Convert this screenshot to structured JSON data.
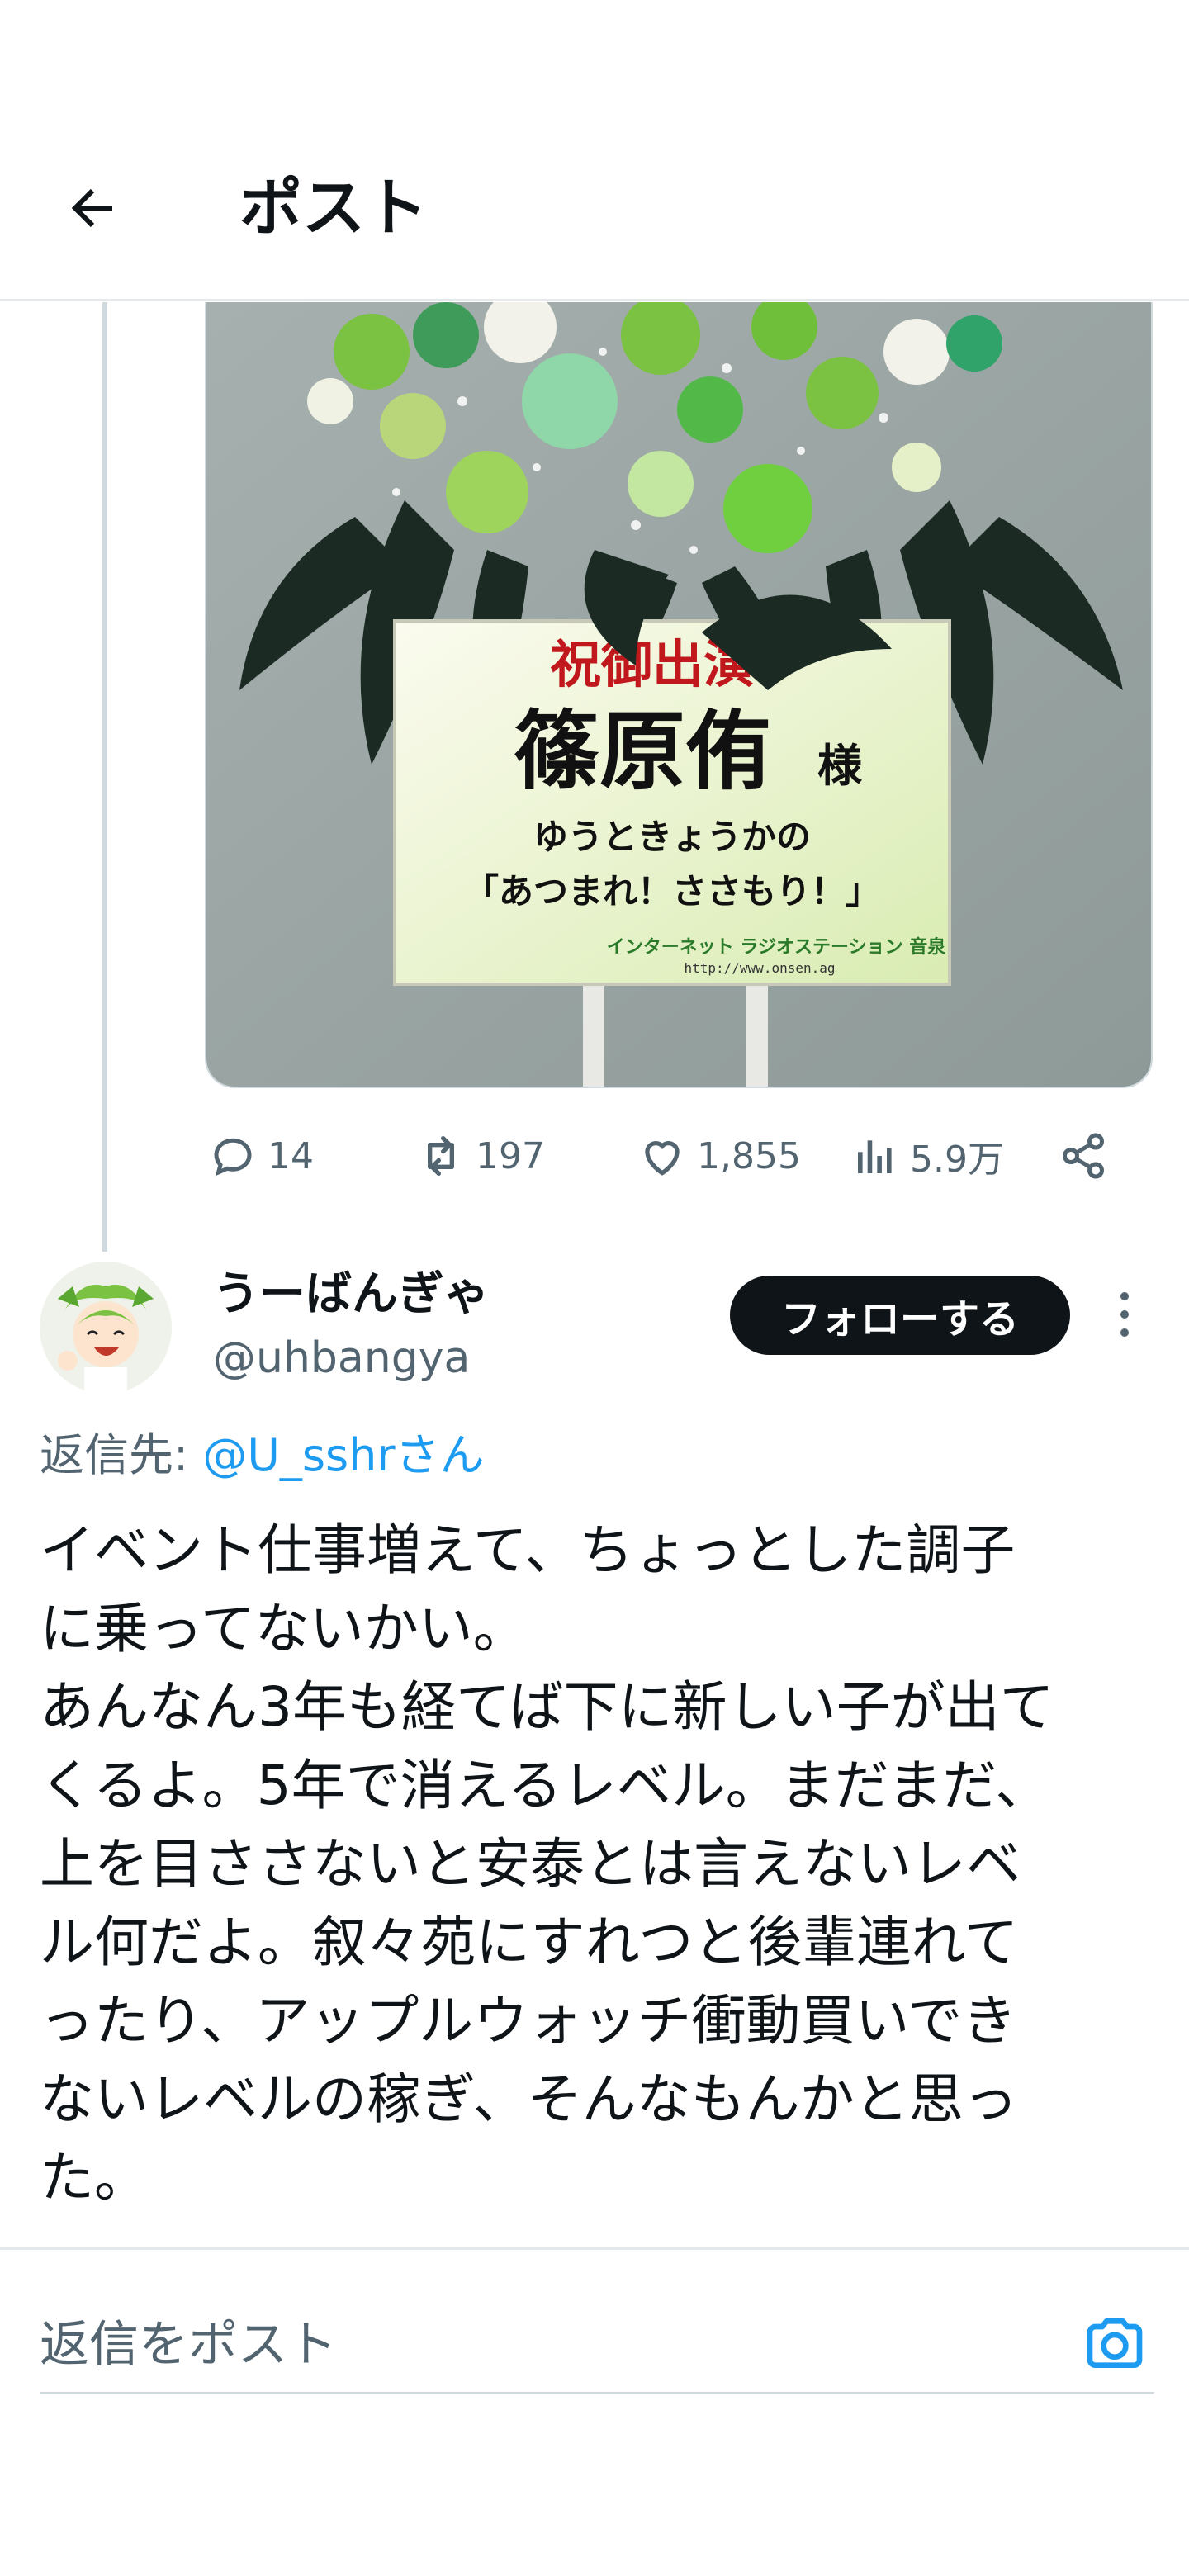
{
  "header": {
    "title": "ポスト",
    "back_icon": "arrow-left-icon"
  },
  "quoted_post": {
    "image": {
      "sign_line1": "祝御出演",
      "sign_name": "篠原侑",
      "sign_honorific": "様",
      "sign_line3": "ゆうときょうかの",
      "sign_line4": "「あつまれ！ささもり！」",
      "sign_logo": "インターネット ラジオステーション 音泉",
      "sign_url": "http://www.onsen.ag"
    },
    "actions": {
      "replies": "14",
      "reposts": "197",
      "likes": "1,855",
      "views": "5.9万"
    }
  },
  "reply_post": {
    "display_name": "うーばんぎゃ",
    "handle": "@uhbangya",
    "follow_label": "フォローする",
    "reply_prefix": "返信先: ",
    "reply_mention": "@U_sshrさん",
    "body": "イベント仕事増えて、ちょっとした調子\nに乗ってないかい。\nあんなん3年も経てば下に新しい子が出て\nくるよ。5年で消えるレベル。まだまだ、\n上を目ささないと安泰とは言えないレベ\nル何だよ。叙々苑にすれつと後輩連れて\nったり、アップルウォッチ衝動買いでき\nないレベルの稼ぎ、そんなもんかと思っ\nた。"
  },
  "composer": {
    "placeholder": "返信をポスト",
    "camera_icon": "camera-icon"
  },
  "colors": {
    "accent": "#1d9bf0",
    "text": "#0f1419",
    "muted": "#536471",
    "follow_bg": "#0f1419"
  }
}
